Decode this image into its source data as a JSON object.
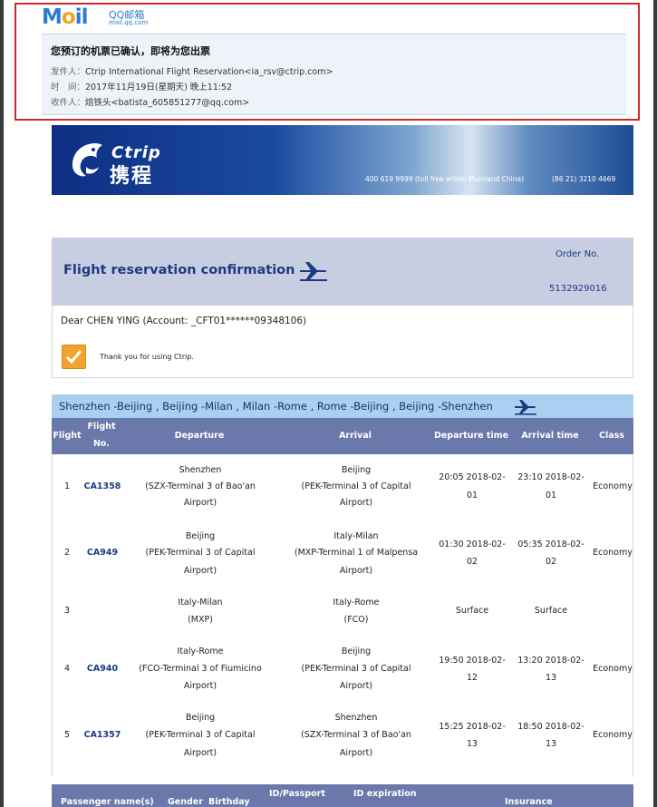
{
  "mail": {
    "logo_m": "M",
    "logo_o": "o",
    "logo_il": "il",
    "logo_cn": "QQ邮箱",
    "logo_domain": "mail.qq.com",
    "subject": "您预订的机票已确认，即将为您出票",
    "from_label": "发件人：",
    "from_value": "Ctrip International Flight Reservation<ia_rsv@ctrip.com>",
    "time_label": "时　间：",
    "time_value": "2017年11月19日(星期天) 晚上11:52",
    "to_label": "收件人：",
    "to_value": "焙铁头<batista_605851277@qq.com>"
  },
  "banner": {
    "brand_en": "Ctrip",
    "brand_cn": "携程",
    "phone_main": "400 619 9999 (toll free within Mainland China)",
    "phone_alt": "(86  21) 3210 4669"
  },
  "confirmation": {
    "title": "Flight reservation confirmation",
    "order_label": "Order No.",
    "order_no": "5132929016",
    "dear": "Dear CHEN YING (Account: _CFT01******09348106)",
    "thanks": "Thank you for using Ctrip."
  },
  "route": "Shenzhen -Beijing , Beijing -Milan , Milan -Rome , Rome -Beijing , Beijing -Shenzhen",
  "table": {
    "headers": {
      "flight": "Flight",
      "flight_no_1": "Flight",
      "flight_no_2": "No.",
      "departure": "Departure",
      "arrival": "Arrival",
      "dep_time": "Departure time",
      "arr_time": "Arrival time",
      "class": "Class"
    },
    "rows": [
      {
        "n": "1",
        "no": "CA1358",
        "dep": [
          "Shenzhen",
          "(SZX-Terminal 3 of Bao'an",
          "Airport)"
        ],
        "arr": [
          "Beijing",
          "(PEK-Terminal 3 of Capital",
          "Airport)"
        ],
        "dt": [
          "20:05 2018-02-",
          "01"
        ],
        "at": [
          "23:10 2018-02-",
          "01"
        ],
        "cls": "Economy"
      },
      {
        "n": "2",
        "no": "CA949",
        "dep": [
          "Beijing",
          "(PEK-Terminal 3 of Capital",
          "Airport)"
        ],
        "arr": [
          "Italy-Milan",
          "(MXP-Terminal 1 of Malpensa",
          "Airport)"
        ],
        "dt": [
          "01:30 2018-02-",
          "02"
        ],
        "at": [
          "05:35 2018-02-",
          "02"
        ],
        "cls": "Economy"
      },
      {
        "n": "3",
        "no": "",
        "dep": [
          "Italy-Milan",
          "(MXP)"
        ],
        "arr": [
          "Italy-Rome",
          "(FCO)"
        ],
        "dt": [
          "Surface"
        ],
        "at": [
          "Surface"
        ],
        "cls": ""
      },
      {
        "n": "4",
        "no": "CA940",
        "dep": [
          "Italy-Rome",
          "(FCO-Terminal 3 of Fiumicino",
          "Airport)"
        ],
        "arr": [
          "Beijing",
          "(PEK-Terminal 3 of Capital",
          "Airport)"
        ],
        "dt": [
          "19:50 2018-02-",
          "12"
        ],
        "at": [
          "13:20 2018-02-",
          "13"
        ],
        "cls": "Economy"
      },
      {
        "n": "5",
        "no": "CA1357",
        "dep": [
          "Beijing",
          "(PEK-Terminal 3 of Capital",
          "Airport)"
        ],
        "arr": [
          "Shenzhen",
          "(SZX-Terminal 3 of Bao'an",
          "Airport)"
        ],
        "dt": [
          "15:25 2018-02-",
          "13"
        ],
        "at": [
          "18:50 2018-02-",
          "13"
        ],
        "cls": "Economy"
      }
    ]
  },
  "passenger_headers": {
    "name": "Passenger name(s)",
    "gender": "Gender",
    "birthday": "Birthday",
    "id": "ID/Passport",
    "id_exp": "ID expiration",
    "insurance": "Insurance"
  }
}
